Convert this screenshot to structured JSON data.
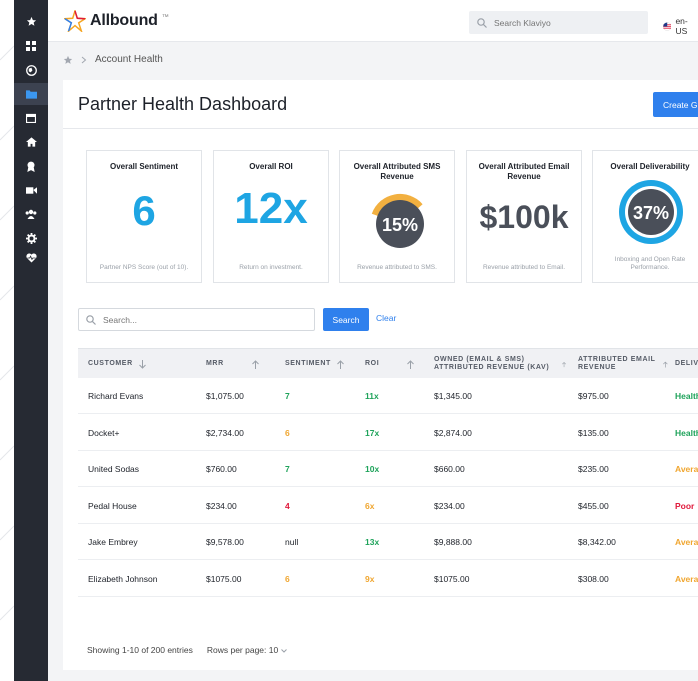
{
  "app": {
    "name": "Allbound",
    "tm": "™",
    "locale": "en-US"
  },
  "search": {
    "placeholder": "Search Klaviyo"
  },
  "sidebar": {
    "items": [
      {
        "icon": "star-icon"
      },
      {
        "icon": "grid-icon"
      },
      {
        "icon": "globe-icon"
      },
      {
        "icon": "folder-icon",
        "active": true
      },
      {
        "icon": "calendar-icon"
      },
      {
        "icon": "home-icon"
      },
      {
        "icon": "award-icon"
      },
      {
        "icon": "video-icon"
      },
      {
        "icon": "users-icon"
      },
      {
        "icon": "gear-icon"
      },
      {
        "icon": "heart-pulse-icon"
      }
    ]
  },
  "breadcrumb": {
    "current": "Account Health"
  },
  "page": {
    "title": "Partner Health Dashboard",
    "create_label": "Create G"
  },
  "cards": [
    {
      "title": "Overall Sentiment",
      "value": "6",
      "sub": "Partner NPS Score (out of 10).",
      "color": "#1ea5e3"
    },
    {
      "title": "Overall ROI",
      "value": "12x",
      "sub": "Return on investment.",
      "color": "#1ea5e3"
    },
    {
      "title": "Overall Attributed SMS Revenue",
      "value": "15%",
      "percent": 15,
      "sub": "Revenue attributed to SMS.",
      "color": "#f2b040"
    },
    {
      "title": "Overall Attributed Email Revenue",
      "value": "$100k",
      "sub": "Revenue attributed to Email.",
      "color": "#4a4f59"
    },
    {
      "title": "Overall Deliverability",
      "value": "37%",
      "percent": 37,
      "sub": "Inboxing and Open Rate Performance.",
      "color": "#1ea5e3"
    }
  ],
  "table_search": {
    "placeholder": "Search...",
    "search_label": "Search",
    "clear_label": "Clear"
  },
  "table": {
    "columns": [
      "CUSTOMER",
      "MRR",
      "SENTIMENT",
      "ROI",
      "OWNED (EMAIL & SMS) ATTRIBUTED REVENUE (KAV)",
      "ATTRIBUTED EMAIL REVENUE",
      "DELIVE"
    ],
    "rows": [
      {
        "customer": "Richard Evans",
        "mrr": "$1,075.00",
        "sentiment": "7",
        "roi": "11x",
        "owned": "$1,345.00",
        "email": "$975.00",
        "deliverability": "Health"
      },
      {
        "customer": "Docket+",
        "mrr": "$2,734.00",
        "sentiment": "6",
        "roi": "17x",
        "owned": "$2,874.00",
        "email": "$135.00",
        "deliverability": "Health"
      },
      {
        "customer": "United Sodas",
        "mrr": "$760.00",
        "sentiment": "7",
        "roi": "10x",
        "owned": "$660.00",
        "email": "$235.00",
        "deliverability": "Averag"
      },
      {
        "customer": "Pedal House",
        "mrr": "$234.00",
        "sentiment": "4",
        "roi": "6x",
        "owned": "$234.00",
        "email": "$455.00",
        "deliverability": "Poor"
      },
      {
        "customer": "Jake Embrey",
        "mrr": "$9,578.00",
        "sentiment": "null",
        "roi": "13x",
        "owned": "$9,888.00",
        "email": "$8,342.00",
        "deliverability": "Averag"
      },
      {
        "customer": "Elizabeth Johnson",
        "mrr": "$1075.00",
        "sentiment": "6",
        "roi": "9x",
        "owned": "$1075.00",
        "email": "$308.00",
        "deliverability": "Averag"
      }
    ]
  },
  "pagination": {
    "showing": "Showing 1-10 of 200 entries",
    "rows_per_page": "Rows per page: 10"
  },
  "colors": {
    "good": "#1fa35b",
    "average": "#f0a630",
    "poor": "#e0193b",
    "accent": "#2f80ed"
  }
}
